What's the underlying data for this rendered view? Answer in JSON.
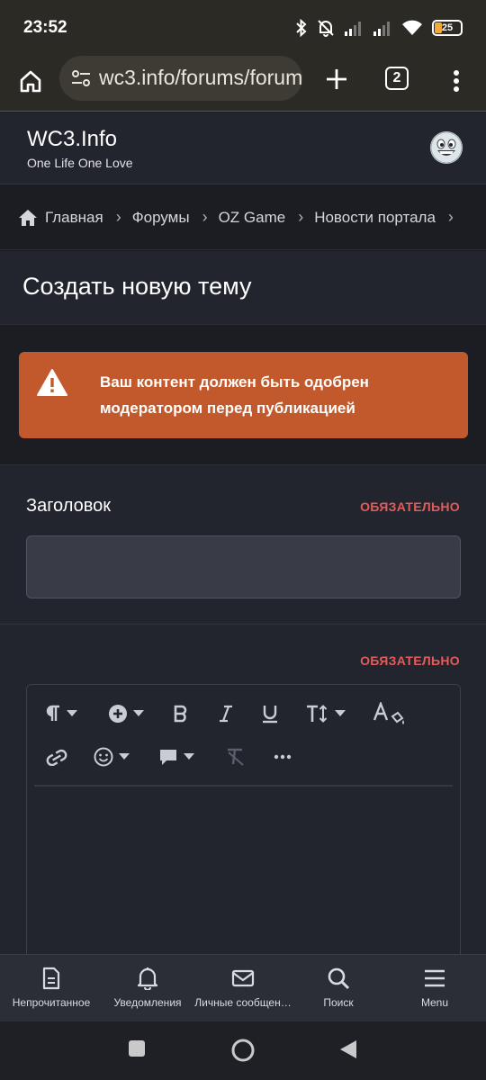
{
  "status_bar": {
    "time": "23:52",
    "battery_level": "25",
    "icons": [
      "bluetooth-icon",
      "mute-icon",
      "signal-icon",
      "signal-icon",
      "wifi-icon",
      "battery-icon"
    ]
  },
  "browser": {
    "url": "wc3.info/forums/forum",
    "tab_count": "2"
  },
  "site": {
    "title": "WC3.Info",
    "subtitle": "One Life One Love"
  },
  "breadcrumb": [
    "Главная",
    "Форумы",
    "OZ Game",
    "Новости портала"
  ],
  "page": {
    "title": "Создать новую тему"
  },
  "alert": {
    "message": "Ваш контент должен быть одобрен модератором перед публикацией",
    "color": "#c1592c"
  },
  "form": {
    "title_label": "Заголовок",
    "required_label": "ОБЯЗАТЕЛЬНО",
    "title_value": "",
    "editor_required_label": "ОБЯЗАТЕЛЬНО"
  },
  "toolbar": {
    "row1": [
      "paragraph-icon",
      "insert-icon",
      "bold-icon",
      "italic-icon",
      "underline-icon",
      "text-size-icon",
      "text-color-icon"
    ],
    "row2": [
      "link-icon",
      "emoji-icon",
      "quote-icon",
      "clear-format-icon",
      "more-icon"
    ]
  },
  "bottom_nav": [
    {
      "label": "Непрочитанное",
      "icon": "document-icon"
    },
    {
      "label": "Уведомления",
      "icon": "bell-icon"
    },
    {
      "label": "Личные сообщен…",
      "icon": "envelope-icon"
    },
    {
      "label": "Поиск",
      "icon": "search-icon"
    },
    {
      "label": "Menu",
      "icon": "menu-icon"
    }
  ]
}
